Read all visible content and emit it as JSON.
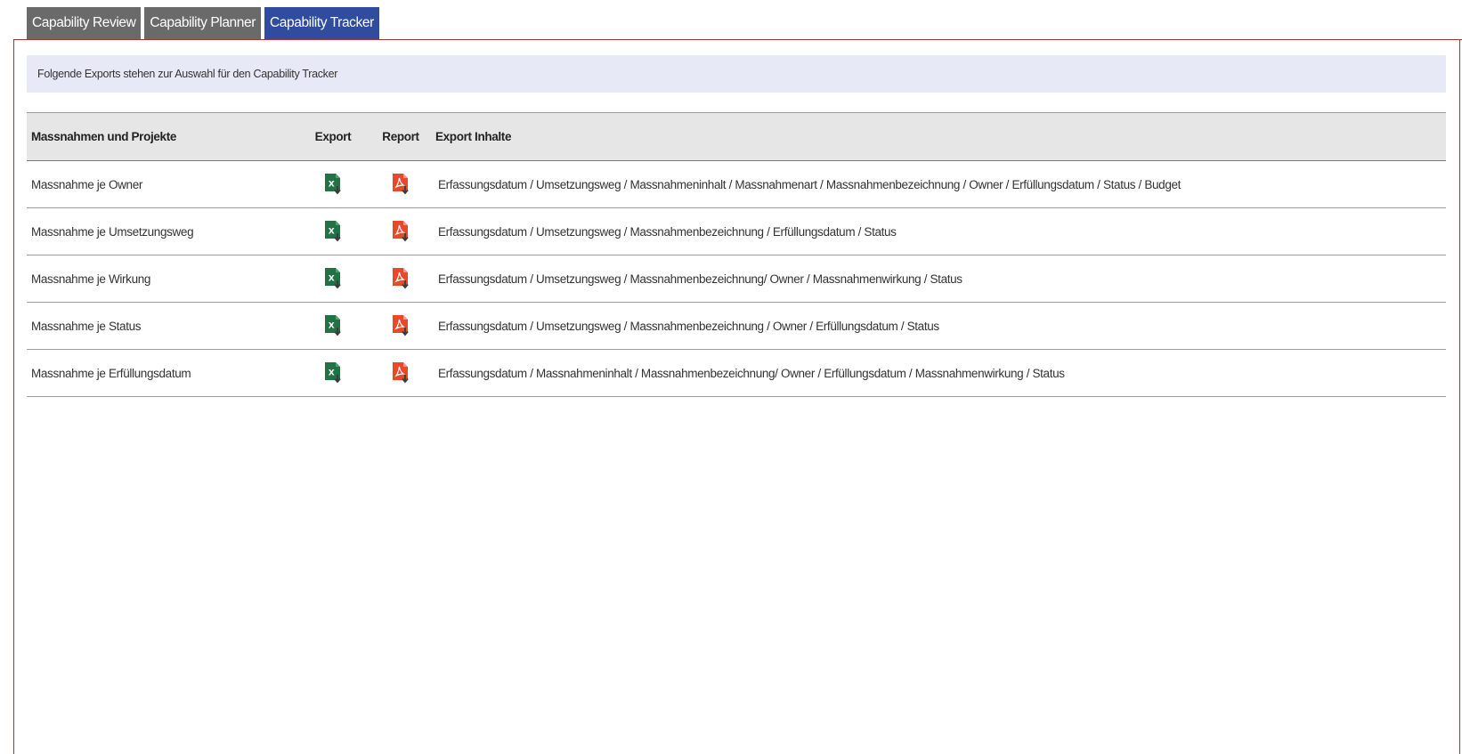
{
  "tabs": [
    {
      "label": "Capability Review",
      "active": false
    },
    {
      "label": "Capability Planner",
      "active": false
    },
    {
      "label": "Capability Tracker",
      "active": true
    }
  ],
  "info_text": "Folgende Exports stehen zur Auswahl für den Capability Tracker",
  "table": {
    "headers": {
      "name": "Massnahmen und Projekte",
      "export": "Export",
      "report": "Report",
      "content": "Export Inhalte"
    },
    "rows": [
      {
        "name": "Massnahme je Owner",
        "export_icon": "excel-download-icon",
        "report_icon": "pdf-download-icon",
        "content": "Erfassungsdatum / Umsetzungsweg / Massnahmeninhalt / Massnahmenart / Massnahmenbezeichnung / Owner / Erfüllungsdatum / Status / Budget"
      },
      {
        "name": "Massnahme je Umsetzungsweg",
        "export_icon": "excel-download-icon",
        "report_icon": "pdf-download-icon",
        "content": "Erfassungsdatum / Umsetzungsweg / Massnahmenbezeichnung / Erfüllungsdatum / Status"
      },
      {
        "name": "Massnahme je Wirkung",
        "export_icon": "excel-download-icon",
        "report_icon": "pdf-download-icon",
        "content": "Erfassungsdatum / Umsetzungsweg / Massnahmenbezeichnung/ Owner / Massnahmenwirkung / Status"
      },
      {
        "name": "Massnahme je Status",
        "export_icon": "excel-download-icon",
        "report_icon": "pdf-download-icon",
        "content": "Erfassungsdatum / Umsetzungsweg / Massnahmenbezeichnung / Owner / Erfüllungsdatum / Status"
      },
      {
        "name": "Massnahme je Erfüllungsdatum",
        "export_icon": "excel-download-icon",
        "report_icon": "pdf-download-icon",
        "content": "Erfassungsdatum / Massnahmeninhalt / Massnahmenbezeichnung/ Owner / Erfüllungsdatum / Massnahmenwirkung / Status"
      }
    ]
  },
  "colors": {
    "tab_inactive": "#6a6a6a",
    "tab_active": "#2f4c9e",
    "panel_border": "#a8323a",
    "info_bar": "#e7eaf6",
    "header_bg": "#e6e6e6",
    "excel_green": "#217346",
    "pdf_red": "#e8492b"
  }
}
